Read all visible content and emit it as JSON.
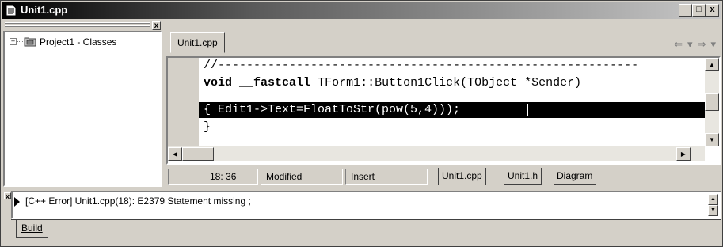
{
  "window": {
    "title": "Unit1.cpp",
    "buttons": {
      "minimize": "_",
      "maximize": "□",
      "close": "x"
    }
  },
  "explorer": {
    "close": "x",
    "tree": {
      "expander": "+",
      "item": "Project1 - Classes"
    }
  },
  "editor": {
    "tab": "Unit1.cpp",
    "nav": {
      "back": "⇐",
      "back_drop": "▾",
      "forward": "⇒",
      "forward_drop": "▾"
    },
    "code": {
      "line1": "//-----------------------------------------------------------",
      "line2_kw1": "void",
      "line2_kw2": "__fastcall",
      "line2_rest": "TForm1::Button1Click(TObject *Sender)",
      "line3": "{ Edit1->Text=FloatToStr(pow(5,4)));",
      "line4": "}"
    },
    "scroll": {
      "up": "▲",
      "down": "▼",
      "left": "◀",
      "right": "▶"
    }
  },
  "status": {
    "position": "18:  36",
    "modified": "Modified",
    "mode": "Insert",
    "tabs": [
      "Unit1.cpp",
      "Unit1.h",
      "Diagram"
    ]
  },
  "messages": {
    "close": "x",
    "items": [
      "[C++ Error] Unit1.cpp(18): E2379 Statement missing ;"
    ],
    "spin_up": "▲",
    "spin_down": "▼",
    "tab": "Build"
  },
  "colors": {
    "face": "#d4d0c8",
    "selection": "#000000",
    "titlebar_start": "#000000"
  }
}
